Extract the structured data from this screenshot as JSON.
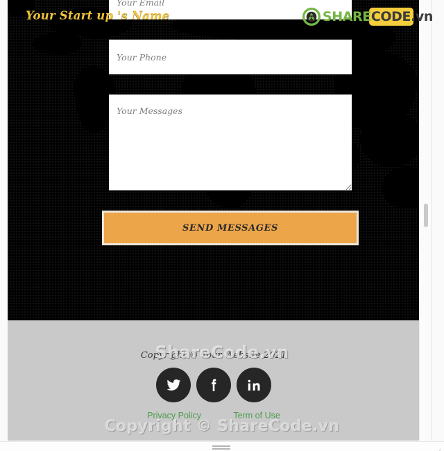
{
  "site": {
    "brand_title": "Your Start up 's Name"
  },
  "contact_form": {
    "email_placeholder": "Your Email",
    "email_value": "",
    "phone_placeholder": "Your Phone",
    "phone_value": "",
    "message_placeholder": "Your Messages",
    "message_value": "",
    "submit_label": "SEND MESSAGES"
  },
  "footer": {
    "copyright": "Copyright © Your Website 2021",
    "socials": [
      {
        "name": "twitter",
        "label": "Twitter"
      },
      {
        "name": "facebook",
        "label": "Facebook"
      },
      {
        "name": "linkedin",
        "label": "LinkedIn"
      }
    ],
    "links": [
      {
        "label": "Privacy Policy"
      },
      {
        "label": "Term of Use"
      }
    ]
  },
  "watermarks": {
    "logo_share": "SHARE",
    "logo_code": "CODE",
    "logo_vn": ".vn",
    "center": "ShareCode.vn",
    "bottom": "Copyright © ShareCode.vn"
  },
  "colors": {
    "accent_orange": "#eda549",
    "brand_gold": "#f0c33c",
    "link_green": "#4b9b4b",
    "footer_gray": "#c9c9c9",
    "section_black": "#000000"
  }
}
